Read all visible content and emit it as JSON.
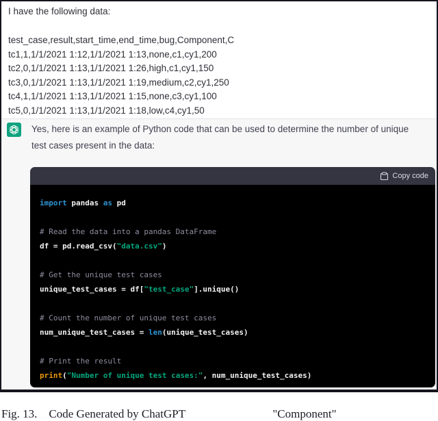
{
  "user_message": {
    "intro": "I have the following data:",
    "csv_lines": [
      "test_case,result,start_time,end_time,bug,Component,C",
      "tc1,1,1/1/2021 1:12,1/1/2021 1:13,none,c1,cy1,200",
      "tc2,0,1/1/2021 1:13,1/1/2021 1:26,high,c1,cy1,150",
      "tc3,0,1/1/2021 1:13,1/1/2021 1:19,medium,c2,cy1,250",
      "tc4,1,1/1/2021 1:13,1/1/2021 1:15,none,c3,cy1,100",
      "tc5,0,1/1/2021 1:13,1/1/2021 1:18,low,c4,cy1,50"
    ]
  },
  "assistant": {
    "avatar": "chatgpt-logo",
    "message_lines": [
      "Yes, here is an example of Python code that can be used to determine the number of unique",
      "test cases present in the data:"
    ],
    "code_block": {
      "copy_button_label": "Copy code",
      "language": "python",
      "lines": [
        [
          {
            "c": "kw",
            "t": "import"
          },
          {
            "c": "",
            "t": " pandas "
          },
          {
            "c": "kw",
            "t": "as"
          },
          {
            "c": "",
            "t": " pd"
          }
        ],
        [],
        [
          {
            "c": "com",
            "t": "# Read the data into a pandas DataFrame"
          }
        ],
        [
          {
            "c": "",
            "t": "df = pd.read_csv("
          },
          {
            "c": "str",
            "t": "\"data.csv\""
          },
          {
            "c": "",
            "t": ")"
          }
        ],
        [],
        [
          {
            "c": "com",
            "t": "# Get the unique test cases"
          }
        ],
        [
          {
            "c": "",
            "t": "unique_test_cases = df["
          },
          {
            "c": "str",
            "t": "\"test_case\""
          },
          {
            "c": "",
            "t": "].unique()"
          }
        ],
        [],
        [
          {
            "c": "com",
            "t": "# Count the number of unique test cases"
          }
        ],
        [
          {
            "c": "",
            "t": "num_unique_test_cases = "
          },
          {
            "c": "kw",
            "t": "len"
          },
          {
            "c": "",
            "t": "(unique_test_cases)"
          }
        ],
        [],
        [
          {
            "c": "com",
            "t": "# Print the result"
          }
        ],
        [
          {
            "c": "fn",
            "t": "print"
          },
          {
            "c": "",
            "t": "("
          },
          {
            "c": "str",
            "t": "\"Number of unique test cases:\""
          },
          {
            "c": "",
            "t": ", num_unique_test_cases)"
          }
        ]
      ]
    }
  },
  "caption": "Fig. 13.    Code Generated by ChatGPT                              \"Component\"",
  "colors": {
    "avatar_green": "#10a37f",
    "assistant_bg": "#f7f7f8",
    "code_header_bg": "#343541",
    "code_bg": "#000000",
    "syntax_keyword": "#2e95d3",
    "syntax_string": "#00a67d",
    "syntax_comment": "#8e8ea0",
    "syntax_function": "#e9950c",
    "copy_text": "#d9d9e3"
  }
}
